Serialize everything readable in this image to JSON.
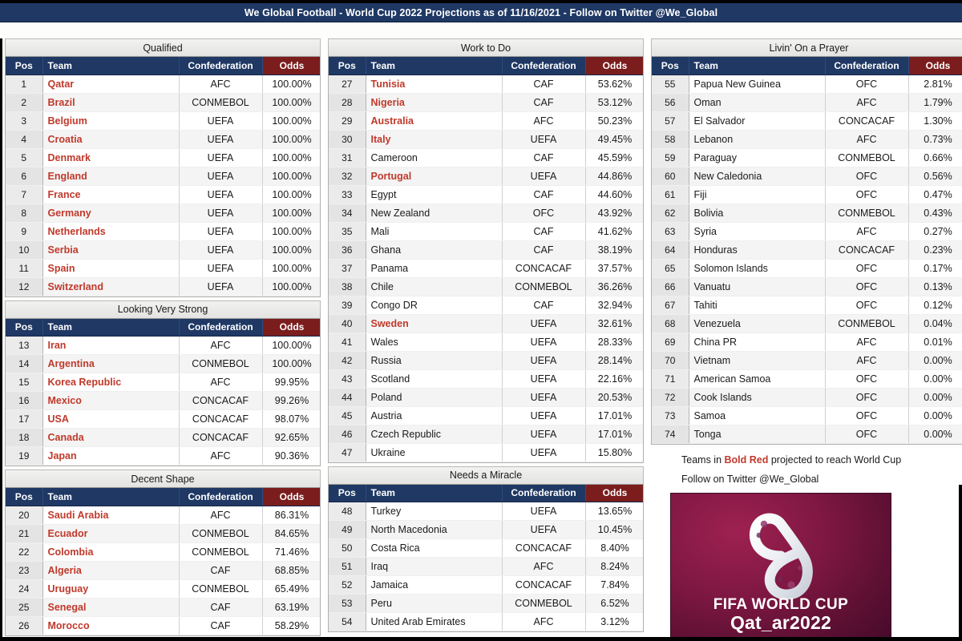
{
  "header": {
    "title": "We Global Football - World Cup 2022 Projections as of 11/16/2021 - Follow on Twitter @We_Global"
  },
  "columns_header": {
    "pos": "Pos",
    "team": "Team",
    "confederation": "Confederation",
    "odds": "Odds"
  },
  "colors": {
    "header_navy": "#1f3864",
    "odds_red": "#7b1d1d",
    "team_red": "#c0392b",
    "banner_gray": "#efefed",
    "logo_maroon": "#7d1742"
  },
  "sections": [
    {
      "id": "qualified",
      "title": "Qualified",
      "column": 1,
      "rows": [
        {
          "pos": "1",
          "team": "Qatar",
          "conf": "AFC",
          "odds": "100.00%",
          "red": true
        },
        {
          "pos": "2",
          "team": "Brazil",
          "conf": "CONMEBOL",
          "odds": "100.00%",
          "red": true
        },
        {
          "pos": "3",
          "team": "Belgium",
          "conf": "UEFA",
          "odds": "100.00%",
          "red": true
        },
        {
          "pos": "4",
          "team": "Croatia",
          "conf": "UEFA",
          "odds": "100.00%",
          "red": true
        },
        {
          "pos": "5",
          "team": "Denmark",
          "conf": "UEFA",
          "odds": "100.00%",
          "red": true
        },
        {
          "pos": "6",
          "team": "England",
          "conf": "UEFA",
          "odds": "100.00%",
          "red": true
        },
        {
          "pos": "7",
          "team": "France",
          "conf": "UEFA",
          "odds": "100.00%",
          "red": true
        },
        {
          "pos": "8",
          "team": "Germany",
          "conf": "UEFA",
          "odds": "100.00%",
          "red": true
        },
        {
          "pos": "9",
          "team": "Netherlands",
          "conf": "UEFA",
          "odds": "100.00%",
          "red": true
        },
        {
          "pos": "10",
          "team": "Serbia",
          "conf": "UEFA",
          "odds": "100.00%",
          "red": true
        },
        {
          "pos": "11",
          "team": "Spain",
          "conf": "UEFA",
          "odds": "100.00%",
          "red": true
        },
        {
          "pos": "12",
          "team": "Switzerland",
          "conf": "UEFA",
          "odds": "100.00%",
          "red": true
        }
      ]
    },
    {
      "id": "looking-very-strong",
      "title": "Looking Very Strong",
      "column": 1,
      "rows": [
        {
          "pos": "13",
          "team": "Iran",
          "conf": "AFC",
          "odds": "100.00%",
          "red": true
        },
        {
          "pos": "14",
          "team": "Argentina",
          "conf": "CONMEBOL",
          "odds": "100.00%",
          "red": true
        },
        {
          "pos": "15",
          "team": "Korea Republic",
          "conf": "AFC",
          "odds": "99.95%",
          "red": true
        },
        {
          "pos": "16",
          "team": "Mexico",
          "conf": "CONCACAF",
          "odds": "99.26%",
          "red": true
        },
        {
          "pos": "17",
          "team": "USA",
          "conf": "CONCACAF",
          "odds": "98.07%",
          "red": true
        },
        {
          "pos": "18",
          "team": "Canada",
          "conf": "CONCACAF",
          "odds": "92.65%",
          "red": true
        },
        {
          "pos": "19",
          "team": "Japan",
          "conf": "AFC",
          "odds": "90.36%",
          "red": true
        }
      ]
    },
    {
      "id": "decent-shape",
      "title": "Decent Shape",
      "column": 1,
      "rows": [
        {
          "pos": "20",
          "team": "Saudi Arabia",
          "conf": "AFC",
          "odds": "86.31%",
          "red": true
        },
        {
          "pos": "21",
          "team": "Ecuador",
          "conf": "CONMEBOL",
          "odds": "84.65%",
          "red": true
        },
        {
          "pos": "22",
          "team": "Colombia",
          "conf": "CONMEBOL",
          "odds": "71.46%",
          "red": true
        },
        {
          "pos": "23",
          "team": "Algeria",
          "conf": "CAF",
          "odds": "68.85%",
          "red": true
        },
        {
          "pos": "24",
          "team": "Uruguay",
          "conf": "CONMEBOL",
          "odds": "65.49%",
          "red": true
        },
        {
          "pos": "25",
          "team": "Senegal",
          "conf": "CAF",
          "odds": "63.19%",
          "red": true
        },
        {
          "pos": "26",
          "team": "Morocco",
          "conf": "CAF",
          "odds": "58.29%",
          "red": true
        }
      ]
    },
    {
      "id": "work-to-do",
      "title": "Work to Do",
      "column": 2,
      "rows": [
        {
          "pos": "27",
          "team": "Tunisia",
          "conf": "CAF",
          "odds": "53.62%",
          "red": true
        },
        {
          "pos": "28",
          "team": "Nigeria",
          "conf": "CAF",
          "odds": "53.12%",
          "red": true
        },
        {
          "pos": "29",
          "team": "Australia",
          "conf": "AFC",
          "odds": "50.23%",
          "red": true
        },
        {
          "pos": "30",
          "team": "Italy",
          "conf": "UEFA",
          "odds": "49.45%",
          "red": true
        },
        {
          "pos": "31",
          "team": "Cameroon",
          "conf": "CAF",
          "odds": "45.59%",
          "red": false
        },
        {
          "pos": "32",
          "team": "Portugal",
          "conf": "UEFA",
          "odds": "44.86%",
          "red": true
        },
        {
          "pos": "33",
          "team": "Egypt",
          "conf": "CAF",
          "odds": "44.60%",
          "red": false
        },
        {
          "pos": "34",
          "team": "New Zealand",
          "conf": "OFC",
          "odds": "43.92%",
          "red": false
        },
        {
          "pos": "35",
          "team": "Mali",
          "conf": "CAF",
          "odds": "41.62%",
          "red": false
        },
        {
          "pos": "36",
          "team": "Ghana",
          "conf": "CAF",
          "odds": "38.19%",
          "red": false
        },
        {
          "pos": "37",
          "team": "Panama",
          "conf": "CONCACAF",
          "odds": "37.57%",
          "red": false
        },
        {
          "pos": "38",
          "team": "Chile",
          "conf": "CONMEBOL",
          "odds": "36.26%",
          "red": false
        },
        {
          "pos": "39",
          "team": "Congo DR",
          "conf": "CAF",
          "odds": "32.94%",
          "red": false
        },
        {
          "pos": "40",
          "team": "Sweden",
          "conf": "UEFA",
          "odds": "32.61%",
          "red": true
        },
        {
          "pos": "41",
          "team": "Wales",
          "conf": "UEFA",
          "odds": "28.33%",
          "red": false
        },
        {
          "pos": "42",
          "team": "Russia",
          "conf": "UEFA",
          "odds": "28.14%",
          "red": false
        },
        {
          "pos": "43",
          "team": "Scotland",
          "conf": "UEFA",
          "odds": "22.16%",
          "red": false
        },
        {
          "pos": "44",
          "team": "Poland",
          "conf": "UEFA",
          "odds": "20.53%",
          "red": false
        },
        {
          "pos": "45",
          "team": "Austria",
          "conf": "UEFA",
          "odds": "17.01%",
          "red": false
        },
        {
          "pos": "46",
          "team": "Czech Republic",
          "conf": "UEFA",
          "odds": "17.01%",
          "red": false
        },
        {
          "pos": "47",
          "team": "Ukraine",
          "conf": "UEFA",
          "odds": "15.80%",
          "red": false
        }
      ]
    },
    {
      "id": "needs-a-miracle",
      "title": "Needs a Miracle",
      "column": 2,
      "rows": [
        {
          "pos": "48",
          "team": "Turkey",
          "conf": "UEFA",
          "odds": "13.65%",
          "red": false
        },
        {
          "pos": "49",
          "team": "North Macedonia",
          "conf": "UEFA",
          "odds": "10.45%",
          "red": false
        },
        {
          "pos": "50",
          "team": "Costa Rica",
          "conf": "CONCACAF",
          "odds": "8.40%",
          "red": false
        },
        {
          "pos": "51",
          "team": "Iraq",
          "conf": "AFC",
          "odds": "8.24%",
          "red": false
        },
        {
          "pos": "52",
          "team": "Jamaica",
          "conf": "CONCACAF",
          "odds": "7.84%",
          "red": false
        },
        {
          "pos": "53",
          "team": "Peru",
          "conf": "CONMEBOL",
          "odds": "6.52%",
          "red": false
        },
        {
          "pos": "54",
          "team": "United Arab Emirates",
          "conf": "AFC",
          "odds": "3.12%",
          "red": false
        }
      ]
    },
    {
      "id": "livin-on-a-prayer",
      "title": "Livin' On a Prayer",
      "column": 3,
      "rows": [
        {
          "pos": "55",
          "team": "Papua New Guinea",
          "conf": "OFC",
          "odds": "2.81%",
          "red": false
        },
        {
          "pos": "56",
          "team": "Oman",
          "conf": "AFC",
          "odds": "1.79%",
          "red": false
        },
        {
          "pos": "57",
          "team": "El Salvador",
          "conf": "CONCACAF",
          "odds": "1.30%",
          "red": false
        },
        {
          "pos": "58",
          "team": "Lebanon",
          "conf": "AFC",
          "odds": "0.73%",
          "red": false
        },
        {
          "pos": "59",
          "team": "Paraguay",
          "conf": "CONMEBOL",
          "odds": "0.66%",
          "red": false
        },
        {
          "pos": "60",
          "team": "New Caledonia",
          "conf": "OFC",
          "odds": "0.56%",
          "red": false
        },
        {
          "pos": "61",
          "team": "Fiji",
          "conf": "OFC",
          "odds": "0.47%",
          "red": false
        },
        {
          "pos": "62",
          "team": "Bolivia",
          "conf": "CONMEBOL",
          "odds": "0.43%",
          "red": false
        },
        {
          "pos": "63",
          "team": "Syria",
          "conf": "AFC",
          "odds": "0.27%",
          "red": false
        },
        {
          "pos": "64",
          "team": "Honduras",
          "conf": "CONCACAF",
          "odds": "0.23%",
          "red": false
        },
        {
          "pos": "65",
          "team": "Solomon Islands",
          "conf": "OFC",
          "odds": "0.17%",
          "red": false
        },
        {
          "pos": "66",
          "team": "Vanuatu",
          "conf": "OFC",
          "odds": "0.13%",
          "red": false
        },
        {
          "pos": "67",
          "team": "Tahiti",
          "conf": "OFC",
          "odds": "0.12%",
          "red": false
        },
        {
          "pos": "68",
          "team": "Venezuela",
          "conf": "CONMEBOL",
          "odds": "0.04%",
          "red": false
        },
        {
          "pos": "69",
          "team": "China PR",
          "conf": "AFC",
          "odds": "0.01%",
          "red": false
        },
        {
          "pos": "70",
          "team": "Vietnam",
          "conf": "AFC",
          "odds": "0.00%",
          "red": false
        },
        {
          "pos": "71",
          "team": "American Samoa",
          "conf": "OFC",
          "odds": "0.00%",
          "red": false
        },
        {
          "pos": "72",
          "team": "Cook Islands",
          "conf": "OFC",
          "odds": "0.00%",
          "red": false
        },
        {
          "pos": "73",
          "team": "Samoa",
          "conf": "OFC",
          "odds": "0.00%",
          "red": false
        },
        {
          "pos": "74",
          "team": "Tonga",
          "conf": "OFC",
          "odds": "0.00%",
          "red": false
        }
      ]
    }
  ],
  "notes": {
    "legend_prefix": "Teams in ",
    "legend_highlight": "Bold Red",
    "legend_suffix": " projected to reach World Cup",
    "twitter": "Follow on Twitter @We_Global"
  },
  "logo": {
    "line1": "FIFA WORLD CUP",
    "line2": "Qat_ar2022",
    "alt": "fifa-world-cup-qatar-2022-emblem"
  }
}
